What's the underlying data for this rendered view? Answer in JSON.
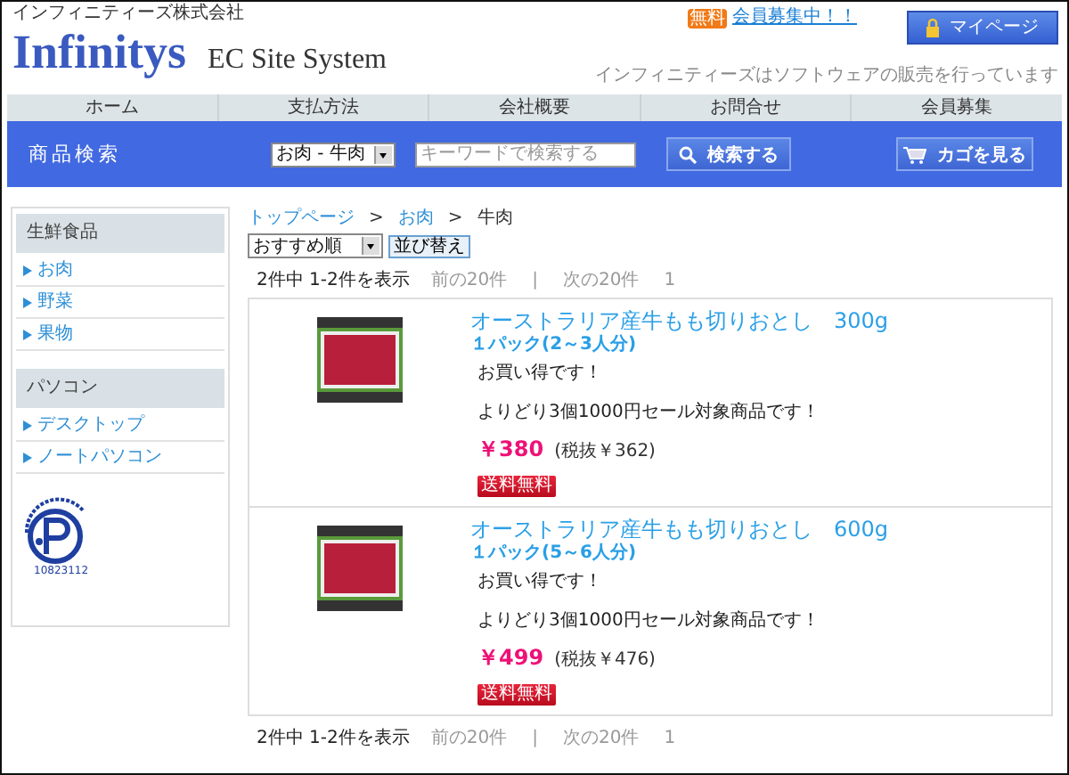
{
  "header": {
    "company": "インフィニティーズ株式会社",
    "logo": "Infinitys",
    "subtitle": "EC Site System",
    "badge": "無料",
    "member_link": "会員募集中！！",
    "mypage_button": "マイページ",
    "tagline": "インフィニティーズはソフトウェアの販売を行っています"
  },
  "nav": [
    "ホーム",
    "支払方法",
    "会社概要",
    "お問合せ",
    "会員募集"
  ],
  "search": {
    "title": "商品検索",
    "category": "お肉 - 牛肉",
    "placeholder": "キーワードで検索する",
    "search_button": "検索する",
    "cart_button": "カゴを見る"
  },
  "sidebar": {
    "sections": [
      {
        "title": "生鮮食品",
        "items": [
          "お肉",
          "野菜",
          "果物"
        ]
      },
      {
        "title": "パソコン",
        "items": [
          "デスクトップ",
          "ノートパソコン"
        ]
      }
    ],
    "privacy_number": "10823112"
  },
  "breadcrumb_separator": ">",
  "breadcrumb": [
    {
      "label": "トップページ",
      "link": true
    },
    {
      "label": "お肉",
      "link": true
    },
    {
      "label": "牛肉",
      "link": false
    }
  ],
  "sort": {
    "value": "おすすめ順",
    "button": "並び替え"
  },
  "pagination_top": {
    "count": "2件中  1-2件を表示",
    "prev": "前の20件",
    "divider": "|",
    "next": "次の20件",
    "page": "1"
  },
  "products": [
    {
      "name": "オーストラリア産牛もも切りおとし　300g",
      "pack": "１パック(2～3人分)",
      "lines": [
        "お買い得です！",
        "よりどり3個1000円セール対象商品です！"
      ],
      "price": "￥380",
      "tax": "(税抜￥362)",
      "badge": "送料無料"
    },
    {
      "name": "オーストラリア産牛もも切りおとし　600g",
      "pack": "１パック(5～6人分)",
      "lines": [
        "お買い得です！",
        "よりどり3個1000円セール対象商品です！"
      ],
      "price": "￥499",
      "tax": "(税抜￥476)",
      "badge": "送料無料"
    }
  ],
  "pagination_bottom": {
    "count": "2件中  1-2件を表示",
    "prev": "前の20件",
    "divider": "|",
    "next": "次の20件",
    "page": "1"
  }
}
